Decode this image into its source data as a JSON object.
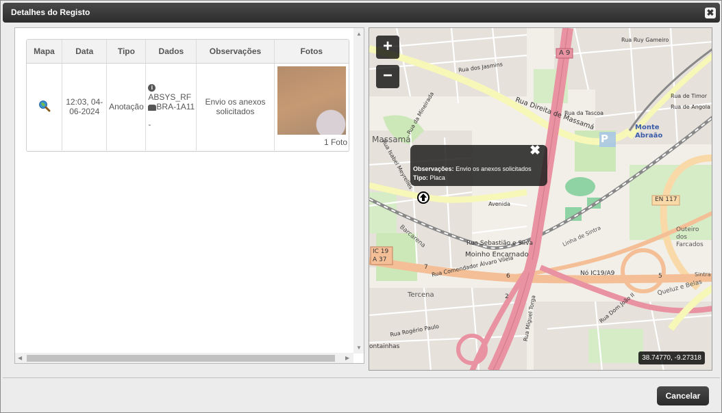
{
  "dialog": {
    "title": "Detalhes do Registo",
    "close_glyph": "✖",
    "cancel_label": "Cancelar"
  },
  "table": {
    "headers": [
      "Mapa",
      "Data",
      "Tipo",
      "Dados",
      "Observações",
      "Fotos"
    ],
    "row": {
      "mapa_icon": "search-map-icon",
      "data": "12:03, 04-06-2024",
      "tipo": "Anotação",
      "dados_line1": "ABSYS_RF",
      "dados_line2": "BRA-1A11",
      "dados_line3": "-",
      "observacoes": "Envio os anexos solicitados",
      "fotos_count": "1 Foto"
    }
  },
  "map": {
    "zoom_in": "+",
    "zoom_out": "−",
    "popup": {
      "obs_label": "Observações:",
      "obs_value": "Envio os anexos solicitados",
      "tipo_label": "Tipo:",
      "tipo_value": "Placa",
      "close": "✖"
    },
    "coordinates": "38.74770, -9.27318",
    "labels": {
      "a9": "A 9",
      "rua_ruy_gameiro": "Rua Ruy Gameiro",
      "rua_dos_jasmins": "Rua dos Jasmins",
      "rua_direita": "Rua Direita de Massamá",
      "rua_da_tascoa": "Rua da Tascoa",
      "rua_de_timor": "Rua de Timor",
      "rua_de_angola": "Rua de Angola",
      "monte_abraao": "Monte Abraão",
      "massama": "Massamá",
      "rua_da_mineirada": "Rua da Mineirada",
      "en117": "EN 117",
      "avenida": "Avenida",
      "rua_sebastiao": "Rua Sebastião e Silva",
      "moinho": "Moinho Encarnado",
      "ic19": "IC 19",
      "a37": "A 37",
      "no_ic19": "Nó IC19/A9",
      "tercena": "Tercena",
      "outeiro": "Outeiro dos Farcados",
      "queluz": "Queluz e Belas",
      "rua_rogerio": "Rua Rogério Paulo",
      "rua_miguel": "Rua Miguel Torga",
      "rua_dom_joao": "Rua Dom João II",
      "sintra": "Sintra",
      "linha_sintra": "Linha de Sintra",
      "rua_comendador": "Rua Comendador Álvaro Vilela",
      "rua_isabel": "Rua Isabel Meyrelles",
      "barcarena": "Barcarena",
      "fontainhas": "ontainhas",
      "parking": "P",
      "num_2": "2",
      "num_5": "5",
      "num_6": "6",
      "num_7": "7"
    }
  }
}
